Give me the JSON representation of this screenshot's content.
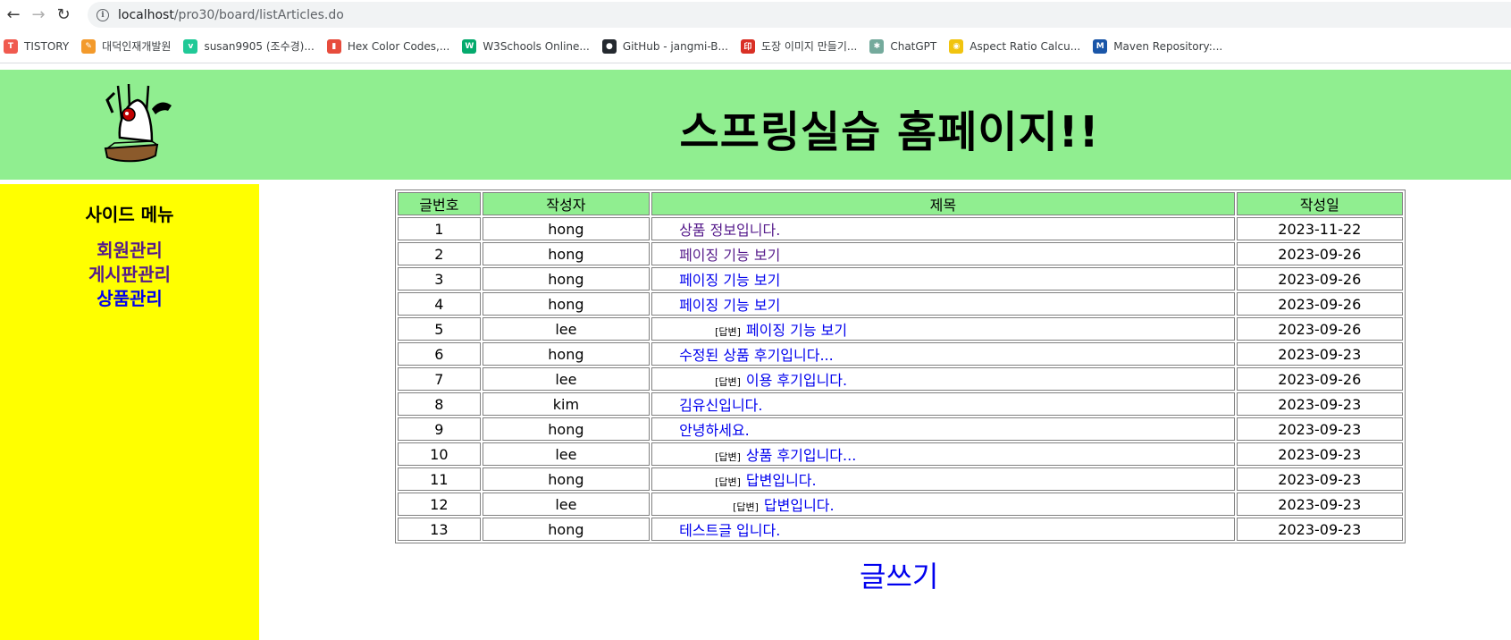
{
  "browser": {
    "url_host": "localhost",
    "url_path": "/pro30/board/listArticles.do",
    "bookmarks": [
      {
        "label": "TISTORY",
        "icon": "tistory-icon",
        "color": "#f05a4f"
      },
      {
        "label": "대덕인재개발원",
        "icon": "ddit-icon",
        "color": "#f39a2b"
      },
      {
        "label": "susan9905 (조수경)...",
        "icon": "velog-icon",
        "color": "#20c997"
      },
      {
        "label": "Hex Color Codes,...",
        "icon": "hex-color-icon",
        "color": "#e74c3c"
      },
      {
        "label": "W3Schools Online...",
        "icon": "w3schools-icon",
        "color": "#04aa6d"
      },
      {
        "label": "GitHub - jangmi-B...",
        "icon": "github-icon",
        "color": "#24292f"
      },
      {
        "label": "도장 이미지 만들기...",
        "icon": "stamp-icon",
        "color": "#d93025"
      },
      {
        "label": "ChatGPT",
        "icon": "chatgpt-icon",
        "color": "#74aa9c"
      },
      {
        "label": "Aspect Ratio Calcu...",
        "icon": "aspect-ratio-icon",
        "color": "#f1c40f"
      },
      {
        "label": "Maven Repository:...",
        "icon": "maven-icon",
        "color": "#1a56a8"
      }
    ]
  },
  "header": {
    "title": "스프링실습 홈페이지!!"
  },
  "sidebar": {
    "title": "사이드 메뉴",
    "links": [
      {
        "label": "회원관리",
        "visited": true
      },
      {
        "label": "게시판관리",
        "visited": true
      },
      {
        "label": "상품관리",
        "visited": false
      }
    ]
  },
  "table": {
    "headers": [
      "글번호",
      "작성자",
      "제목",
      "작성일"
    ],
    "rows": [
      {
        "no": "1",
        "writer": "hong",
        "title": "상품 정보입니다.",
        "date": "2023-11-22",
        "reply": false,
        "depth": 0,
        "visited": true
      },
      {
        "no": "2",
        "writer": "hong",
        "title": "페이징 기능 보기",
        "date": "2023-09-26",
        "reply": false,
        "depth": 0,
        "visited": true
      },
      {
        "no": "3",
        "writer": "hong",
        "title": "페이징 기능 보기",
        "date": "2023-09-26",
        "reply": false,
        "depth": 0,
        "visited": false
      },
      {
        "no": "4",
        "writer": "hong",
        "title": "페이징 기능 보기",
        "date": "2023-09-26",
        "reply": false,
        "depth": 0,
        "visited": false
      },
      {
        "no": "5",
        "writer": "lee",
        "title": "페이징 기능 보기",
        "date": "2023-09-26",
        "reply": true,
        "depth": 1,
        "visited": false
      },
      {
        "no": "6",
        "writer": "hong",
        "title": "수정된 상품 후기입니다...",
        "date": "2023-09-23",
        "reply": false,
        "depth": 0,
        "visited": false
      },
      {
        "no": "7",
        "writer": "lee",
        "title": "이용 후기입니다.",
        "date": "2023-09-26",
        "reply": true,
        "depth": 1,
        "visited": false
      },
      {
        "no": "8",
        "writer": "kim",
        "title": "김유신입니다.",
        "date": "2023-09-23",
        "reply": false,
        "depth": 0,
        "visited": false
      },
      {
        "no": "9",
        "writer": "hong",
        "title": "안녕하세요.",
        "date": "2023-09-23",
        "reply": false,
        "depth": 0,
        "visited": false
      },
      {
        "no": "10",
        "writer": "lee",
        "title": "상품 후기입니다...",
        "date": "2023-09-23",
        "reply": true,
        "depth": 1,
        "visited": false
      },
      {
        "no": "11",
        "writer": "hong",
        "title": "답변입니다.",
        "date": "2023-09-23",
        "reply": true,
        "depth": 1,
        "visited": false
      },
      {
        "no": "12",
        "writer": "lee",
        "title": "답변입니다.",
        "date": "2023-09-23",
        "reply": true,
        "depth": 2,
        "visited": false
      },
      {
        "no": "13",
        "writer": "hong",
        "title": "테스트글 입니다.",
        "date": "2023-09-23",
        "reply": false,
        "depth": 0,
        "visited": false
      }
    ],
    "reply_tag": "[답변]"
  },
  "write_link": "글쓰기",
  "colors": {
    "header_bg": "#90ee90",
    "sidebar_bg": "#ffff00",
    "link": "#0000ee",
    "visited_link": "#551a8b"
  }
}
